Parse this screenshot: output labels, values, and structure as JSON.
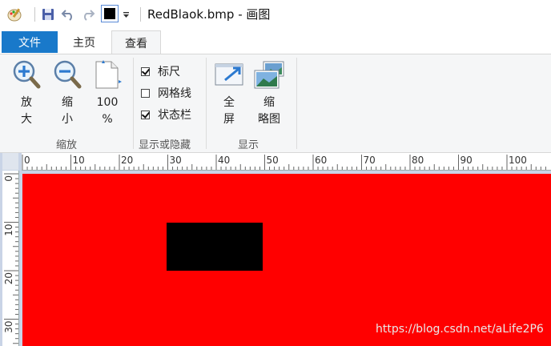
{
  "window": {
    "title": "RedBlaok.bmp - 画图"
  },
  "quick_access": {
    "app_icon": "paint-palette-icon",
    "save_icon": "save-icon",
    "undo_icon": "undo-icon",
    "redo_icon": "redo-icon",
    "current_color": "#000000",
    "customize_icon": "dropdown-arrow-icon"
  },
  "tabs": {
    "file": "文件",
    "home": "主页",
    "view": "查看"
  },
  "ribbon": {
    "zoom": {
      "zoom_in": "放\n大",
      "zoom_out": "缩\n小",
      "actual": "100\n%",
      "group_label": "缩放"
    },
    "show_hide": {
      "ruler": {
        "label": "标尺",
        "checked": true
      },
      "gridlines": {
        "label": "网格线",
        "checked": false
      },
      "statusbar": {
        "label": "状态栏",
        "checked": true
      },
      "group_label": "显示或隐藏"
    },
    "display": {
      "fullscreen": "全\n屏",
      "thumbnail": "缩\n略图",
      "group_label": "显示"
    }
  },
  "rulers": {
    "horizontal_ticks": [
      "0",
      "10",
      "20",
      "30",
      "40",
      "50",
      "60",
      "70",
      "80",
      "90",
      "100"
    ],
    "vertical_ticks": [
      "0",
      "10",
      "20",
      "30"
    ]
  },
  "canvas": {
    "background": "#ff0000",
    "shape_color": "#000000"
  },
  "watermark": "https://blog.csdn.net/aLife2P6"
}
